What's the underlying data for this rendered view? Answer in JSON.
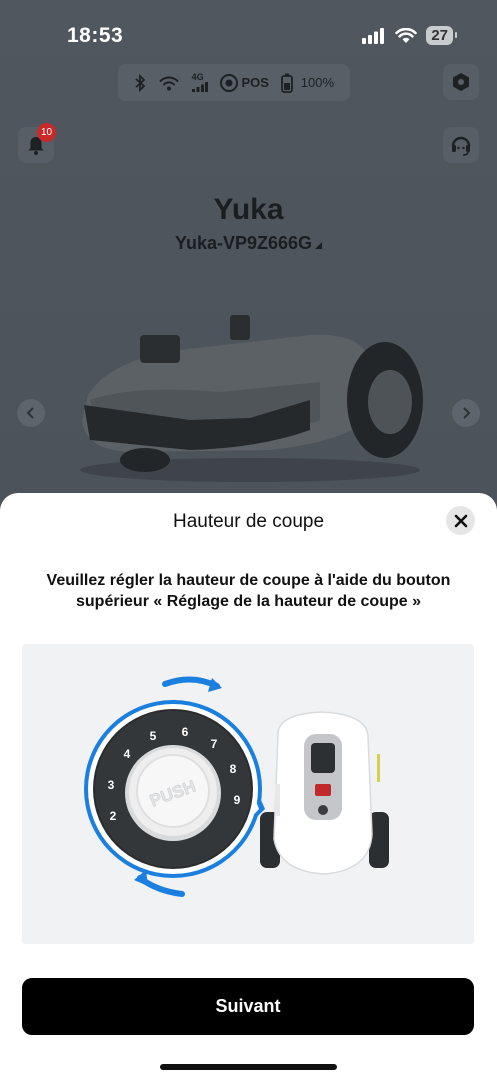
{
  "status_bar": {
    "time": "18:53",
    "battery_level": "27",
    "icons": [
      "signal-icon",
      "wifi-icon",
      "battery-icon"
    ]
  },
  "robot_status": {
    "network_label": "4G",
    "pos_label": "POS",
    "battery_label": "100%",
    "icons": [
      "bluetooth-icon",
      "wifi-icon",
      "cellular-icon",
      "rtk-pos-icon",
      "battery-icon"
    ]
  },
  "notifications": {
    "badge_count": "10"
  },
  "device": {
    "name": "Yuka",
    "model": "Yuka-VP9Z666G"
  },
  "sheet": {
    "title": "Hauteur de coupe",
    "instruction": "Veuillez régler la hauteur de coupe à l'aide du bouton supérieur « Réglage de la hauteur de coupe »",
    "dial_label": "PUSH",
    "dial_numbers": [
      "2",
      "3",
      "4",
      "5",
      "6",
      "7",
      "8",
      "9"
    ],
    "next_label": "Suivant"
  },
  "colors": {
    "accent_blue": "#1b7fe0",
    "overlay": "#4c535a",
    "button_bg": "#000000"
  }
}
